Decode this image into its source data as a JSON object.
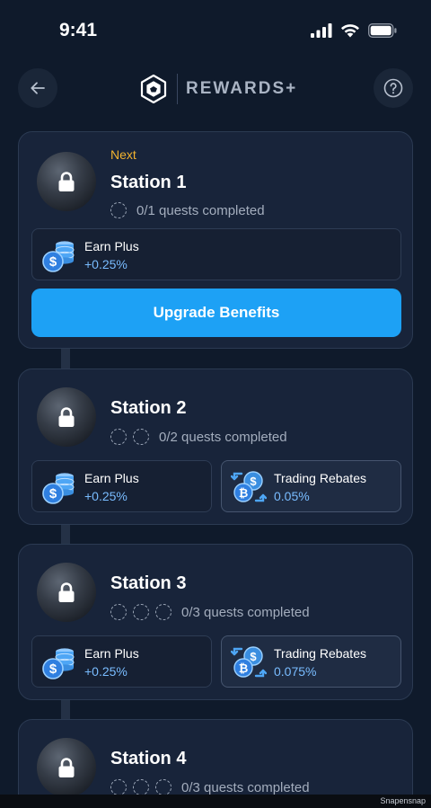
{
  "status_bar": {
    "time": "9:41"
  },
  "header": {
    "title": "REWARDS+"
  },
  "stations": [
    {
      "label": "Next",
      "title": "Station 1",
      "quests_text": "0/1 quests completed",
      "benefits": [
        {
          "name": "Earn Plus",
          "value": "+0.25%"
        }
      ],
      "upgrade_label": "Upgrade Benefits"
    },
    {
      "title": "Station 2",
      "quests_text": "0/2 quests completed",
      "benefits": [
        {
          "name": "Earn Plus",
          "value": "+0.25%"
        },
        {
          "name": "Trading Rebates",
          "value": "0.05%"
        }
      ]
    },
    {
      "title": "Station 3",
      "quests_text": "0/3 quests completed",
      "benefits": [
        {
          "name": "Earn Plus",
          "value": "+0.25%"
        },
        {
          "name": "Trading Rebates",
          "value": "0.075%"
        }
      ]
    },
    {
      "title": "Station 4",
      "quests_text": "0/3 quests completed"
    }
  ],
  "watermark": "Snapensnap",
  "colors": {
    "accent": "#1da1f5",
    "next_label": "#f2b32f",
    "benefit_value": "#79bcff",
    "background": "#0f1a2b"
  }
}
